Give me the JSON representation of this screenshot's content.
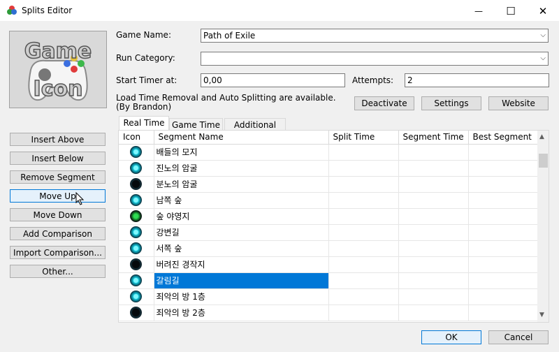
{
  "window": {
    "title": "Splits Editor"
  },
  "titlebar_buttons": {
    "minimize": "—",
    "maximize": "☐",
    "close": "✕"
  },
  "form": {
    "game_name_label": "Game Name:",
    "game_name_value": "Path of Exile",
    "run_category_label": "Run Category:",
    "run_category_value": "",
    "start_timer_label": "Start Timer at:",
    "start_timer_value": "0,00",
    "attempts_label": "Attempts:",
    "attempts_value": "2",
    "autosplit_text": "Load Time Removal and Auto Splitting are available. (By Brandon)"
  },
  "autosplit_buttons": {
    "deactivate": "Deactivate",
    "settings": "Settings",
    "website": "Website"
  },
  "game_icon": {
    "text_line1": "Game",
    "text_line2": "Icon"
  },
  "side_buttons": [
    "Insert Above",
    "Insert Below",
    "Remove Segment",
    "Move Up",
    "Move Down",
    "Add Comparison",
    "Import Comparison...",
    "Other..."
  ],
  "tabs": [
    "Real Time",
    "Game Time",
    "Additional Info"
  ],
  "columns": [
    "Icon",
    "Segment Name",
    "Split Time",
    "Segment Time",
    "Best Segment"
  ],
  "segments": [
    {
      "icon": "cyan",
      "name": "배들의 모지",
      "selected": false
    },
    {
      "icon": "cyan",
      "name": "진노의 암굴",
      "selected": false
    },
    {
      "icon": "dark",
      "name": "분노의 암굴",
      "selected": false
    },
    {
      "icon": "cyan",
      "name": "남쪽 숲",
      "selected": false
    },
    {
      "icon": "green",
      "name": "숲 야영지",
      "selected": false
    },
    {
      "icon": "cyan",
      "name": "강변길",
      "selected": false
    },
    {
      "icon": "cyan",
      "name": "서쪽 숲",
      "selected": false
    },
    {
      "icon": "dark",
      "name": "버려진 경작지",
      "selected": false
    },
    {
      "icon": "cyan",
      "name": "갈림길",
      "selected": true
    },
    {
      "icon": "cyan",
      "name": "죄악의 방 1층",
      "selected": false
    },
    {
      "icon": "dark",
      "name": "죄악의 방 2층",
      "selected": false
    }
  ],
  "footer": {
    "ok": "OK",
    "cancel": "Cancel"
  },
  "colors": {
    "selection": "#0078d7",
    "focus_border": "#0078d7"
  }
}
